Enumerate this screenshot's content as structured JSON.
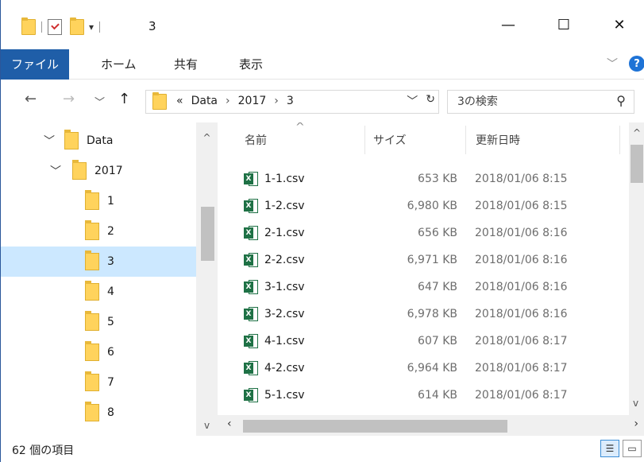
{
  "window": {
    "title": "3",
    "minimize": "—",
    "maximize": "☐",
    "close": "✕",
    "qa_dropdown": "▾"
  },
  "ribbon": {
    "tabs": [
      "ファイル",
      "ホーム",
      "共有",
      "表示"
    ],
    "expand": "﹀",
    "help": "?"
  },
  "nav": {
    "back": "←",
    "forward": "→",
    "recent": "﹀",
    "up": "↑",
    "breadcrumb_overflow": "«",
    "breadcrumbs": [
      "Data",
      "2017",
      "3"
    ],
    "crumb_separator": "›",
    "addr_dropdown": "﹀",
    "refresh": "↻",
    "search_placeholder": "3の検索",
    "search_icon": "⚲"
  },
  "tree": {
    "items": [
      {
        "label": "Data",
        "chevron": "﹀"
      },
      {
        "label": "2017",
        "chevron": "﹀"
      },
      {
        "label": "1"
      },
      {
        "label": "2"
      },
      {
        "label": "3"
      },
      {
        "label": "4"
      },
      {
        "label": "5"
      },
      {
        "label": "6"
      },
      {
        "label": "7"
      },
      {
        "label": "8"
      }
    ]
  },
  "columns": {
    "name": "名前",
    "size": "サイズ",
    "modified": "更新日時",
    "sort_indicator": "^"
  },
  "files": [
    {
      "name": "1-1.csv",
      "size": "653 KB",
      "date": "2018/01/06 8:15"
    },
    {
      "name": "1-2.csv",
      "size": "6,980 KB",
      "date": "2018/01/06 8:15"
    },
    {
      "name": "2-1.csv",
      "size": "656 KB",
      "date": "2018/01/06 8:16"
    },
    {
      "name": "2-2.csv",
      "size": "6,971 KB",
      "date": "2018/01/06 8:16"
    },
    {
      "name": "3-1.csv",
      "size": "647 KB",
      "date": "2018/01/06 8:16"
    },
    {
      "name": "3-2.csv",
      "size": "6,978 KB",
      "date": "2018/01/06 8:16"
    },
    {
      "name": "4-1.csv",
      "size": "607 KB",
      "date": "2018/01/06 8:17"
    },
    {
      "name": "4-2.csv",
      "size": "6,964 KB",
      "date": "2018/01/06 8:17"
    },
    {
      "name": "5-1.csv",
      "size": "614 KB",
      "date": "2018/01/06 8:17"
    }
  ],
  "status": {
    "item_count": "62 個の項目"
  },
  "icons": {
    "folder_color": "#ffd35c",
    "excel_color": "#1e7145",
    "accent": "#1f5ea8",
    "selection": "#cce8ff"
  }
}
